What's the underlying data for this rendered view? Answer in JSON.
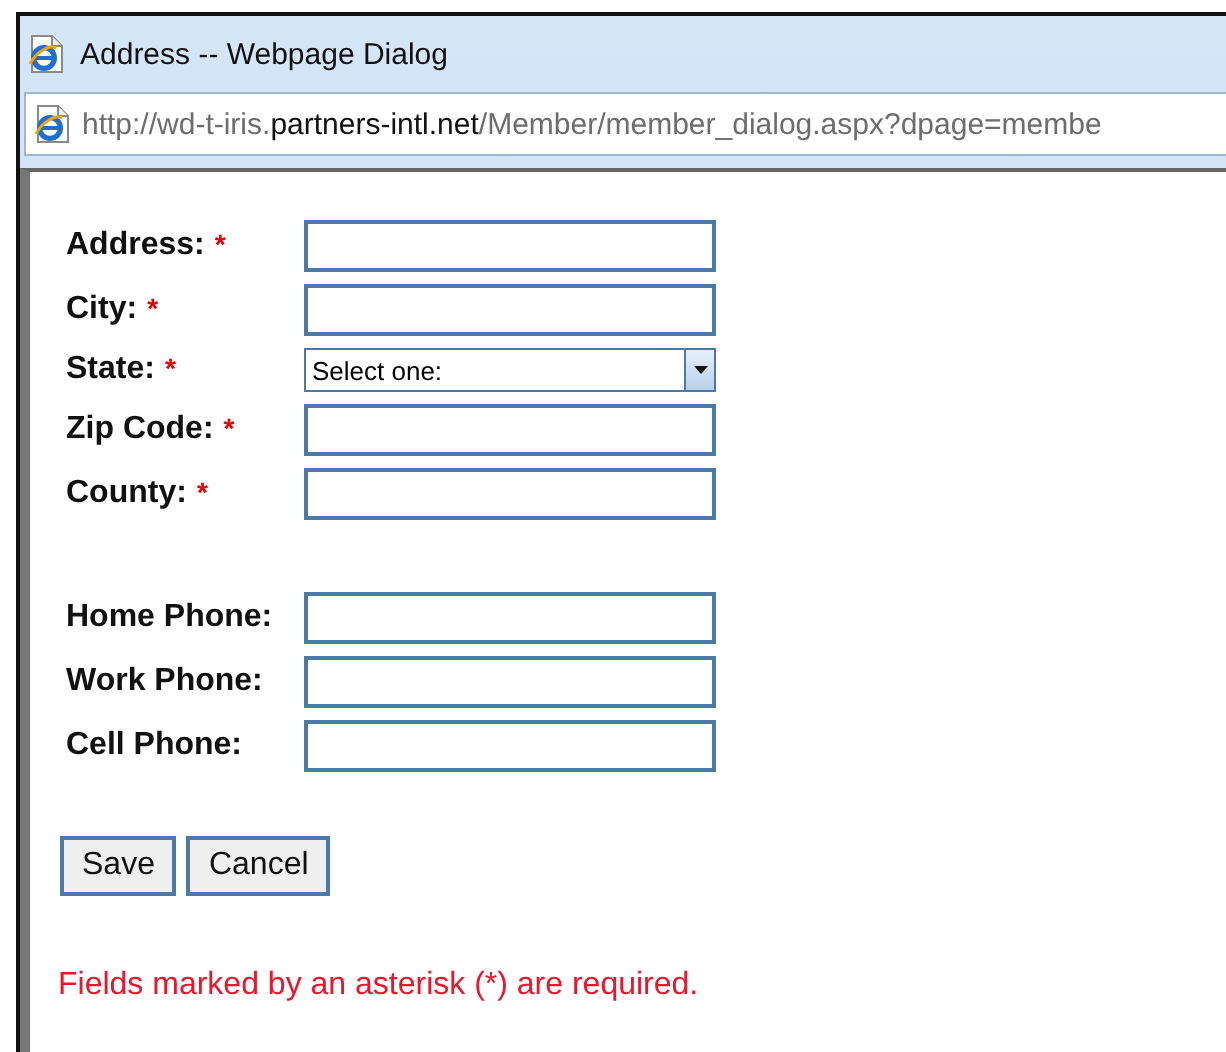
{
  "window": {
    "title": "Address -- Webpage Dialog"
  },
  "address_bar": {
    "url": "http://wd-t-iris.**partners-intl.net**/Member/member_dialog.aspx?dpage=membe"
  },
  "form": {
    "groups": [
      {
        "fields": [
          {
            "kind": "text",
            "label": "Address:",
            "marker": "*"
          },
          {
            "kind": "text",
            "label": "City:",
            "marker": "*"
          },
          {
            "kind": "select",
            "label": "State:",
            "marker": "*",
            "value": "Select one:"
          },
          {
            "kind": "text",
            "label": "Zip Code:",
            "marker": "*"
          },
          {
            "kind": "text",
            "label": "County:",
            "marker": "*"
          }
        ]
      },
      {
        "fields": [
          {
            "kind": "text",
            "label": "Home Phone:"
          },
          {
            "kind": "text",
            "label": "Work Phone:"
          },
          {
            "kind": "text",
            "label": "Cell Phone:"
          }
        ]
      }
    ],
    "buttons": [
      "Save",
      "Cancel"
    ],
    "note": "Fields marked by an asterisk (*) are required."
  }
}
